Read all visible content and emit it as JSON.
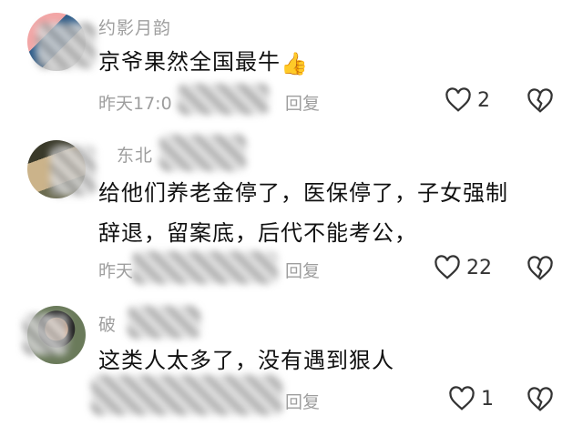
{
  "comments": [
    {
      "username": "约影月韵",
      "text": "京爷果然全国最牛",
      "emoji": "👍",
      "time": "昨天17:0",
      "reply_label": "回复",
      "likes": "2"
    },
    {
      "username": "东北",
      "text_line1": "给他们养老金停了，医保停了，子女强制",
      "text_line2": "辞退，留案底，后代不能考公，",
      "time": "昨天",
      "reply_label": "回复",
      "likes": "22"
    },
    {
      "username": "破",
      "text": "这类人太多了，没有遇到狠人",
      "time": "",
      "reply_label": "回复",
      "likes": "1"
    }
  ],
  "icons": {
    "like": "heart-outline-icon",
    "dislike": "broken-heart-icon"
  },
  "colors": {
    "text": "#111111",
    "meta": "#9e9e9e",
    "icon": "#333333"
  }
}
